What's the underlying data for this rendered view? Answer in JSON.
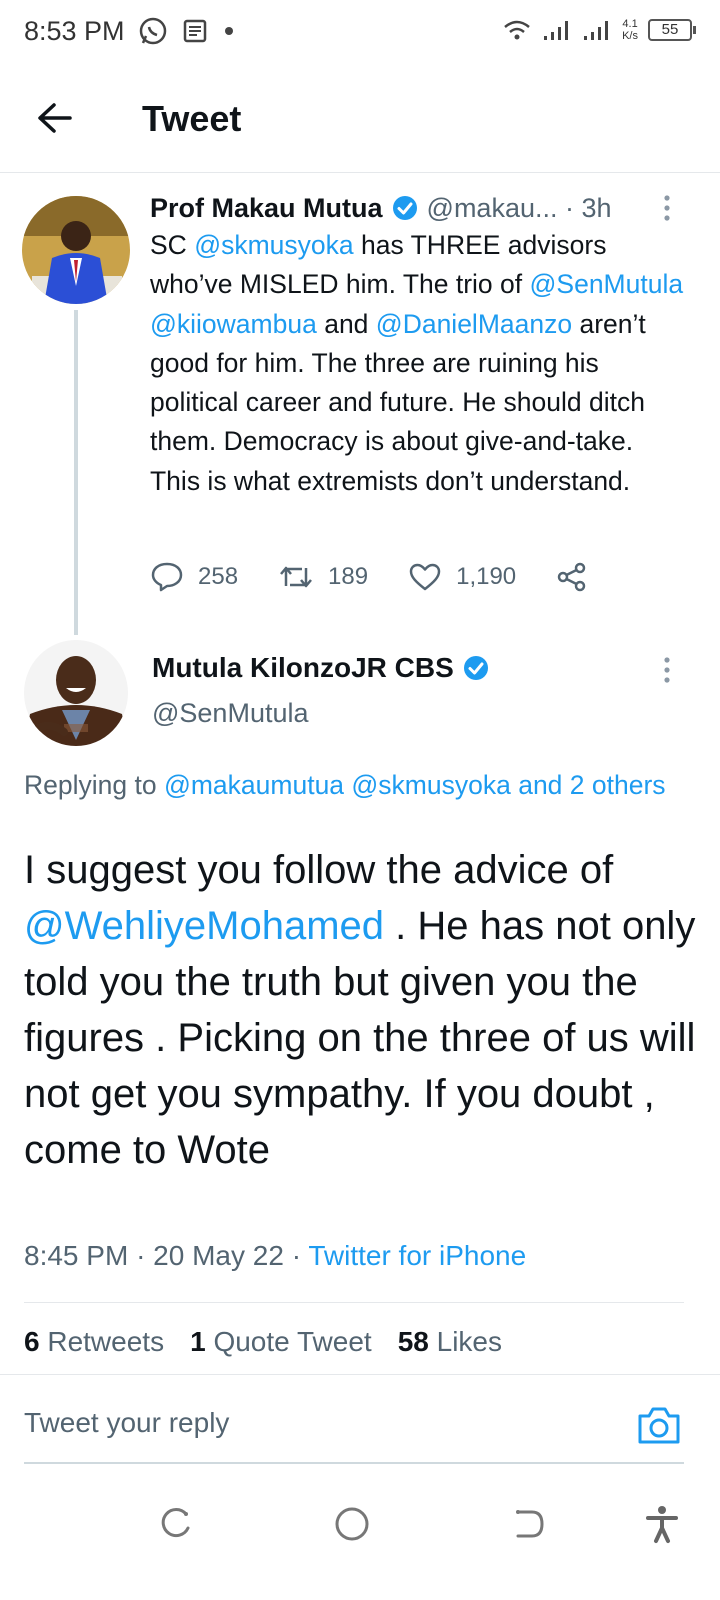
{
  "status_bar": {
    "time": "8:53 PM",
    "speed_value": "4.1",
    "speed_unit": "K/s",
    "battery": "55",
    "icons": [
      "whatsapp-icon",
      "news-icon",
      "dot-icon",
      "wifi-icon",
      "signal-icon",
      "signal-icon"
    ]
  },
  "header": {
    "title": "Tweet",
    "back_icon": "arrow-left-icon"
  },
  "parent_tweet": {
    "name": "Prof Makau Mutua",
    "handle": "@makau...",
    "time": "3h",
    "text_parts": [
      {
        "t": "SC ",
        "link": false
      },
      {
        "t": "@skmusyoka",
        "link": true
      },
      {
        "t": " has THREE advisors who’ve MISLED him. The trio of ",
        "link": false
      },
      {
        "t": "@SenMutula",
        "link": true
      },
      {
        "t": " ",
        "link": false
      },
      {
        "t": "@kiiowambua",
        "link": true
      },
      {
        "t": " and ",
        "link": false
      },
      {
        "t": "@DanielMaanzo",
        "link": true
      },
      {
        "t": " aren’t good for him. The three are ruining his political career and future. He should ditch them. Democracy is about give-and-take. This is what extremists don’t understand.",
        "link": false
      }
    ],
    "replies": "258",
    "retweets": "189",
    "likes": "1,190"
  },
  "main_tweet": {
    "name": "Mutula KilonzoJR CBS",
    "handle": "@SenMutula",
    "replying_label": "Replying to",
    "replying_to": "@makaumutua @skmusyoka and 2 others",
    "text_parts": [
      {
        "t": "I suggest you follow the  advice of ",
        "link": false
      },
      {
        "t": "@WehliyeMohamed",
        "link": true
      },
      {
        "t": " .  He has not only told you the truth but given you the figures . Picking on the three of us will not get you sympathy. If you doubt , come to Wote",
        "link": false
      }
    ],
    "time": "8:45 PM",
    "date": "20 May 22",
    "source": "Twitter for iPhone",
    "retweets_count": "6",
    "retweets_label": "Retweets",
    "quotes_count": "1",
    "quotes_label": "Quote Tweet",
    "likes_count": "58",
    "likes_label": "Likes"
  },
  "reply_box": {
    "placeholder": "Tweet your reply"
  },
  "colors": {
    "accent": "#1d9bf0",
    "text": "#0f1419",
    "secondary": "#536471",
    "divider": "#e5e8eb"
  }
}
